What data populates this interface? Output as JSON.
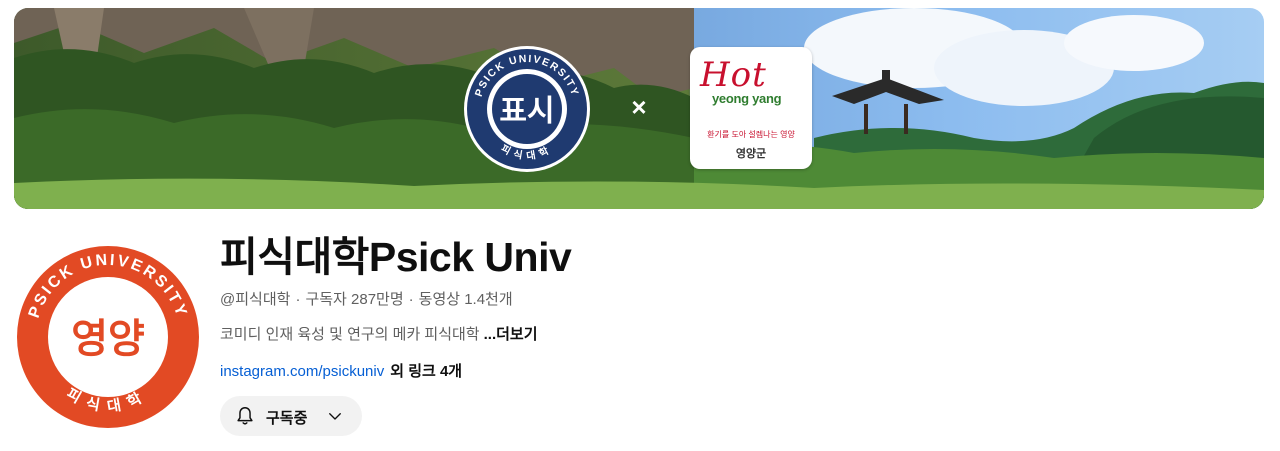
{
  "banner": {
    "seal_top_text": "PSICK UNIVERSITY",
    "seal_center_text": "표시",
    "seal_bottom_text": "피식대학",
    "separator": "×",
    "partner_logo": {
      "word": "Hot",
      "sub": "yeong yang",
      "slogan": "환기를 도아 설렘나는 영양",
      "county": "영양군"
    }
  },
  "avatar": {
    "top_text": "PSICK UNIVERSITY",
    "center_text": "영양",
    "bottom_text": "피식대학",
    "color": "#e24a24"
  },
  "channel": {
    "name": "피식대학Psick Univ",
    "handle": "@피식대학",
    "subscribers": "구독자 287만명",
    "videos": "동영상 1.4천개",
    "description": "코미디 인재 육성 및 연구의 메카 피식대학",
    "more_label": "...더보기",
    "link_text": "instagram.com/psickuniv",
    "more_links": "외 링크 4개"
  },
  "subscribe": {
    "label": "구독중",
    "bell_icon": "bell-icon",
    "chevron_icon": "chevron-down-icon"
  },
  "colors": {
    "link": "#065fd4",
    "seal_navy": "#1f3a70",
    "avatar_orange": "#e24a24",
    "button_bg": "#f2f2f2"
  }
}
